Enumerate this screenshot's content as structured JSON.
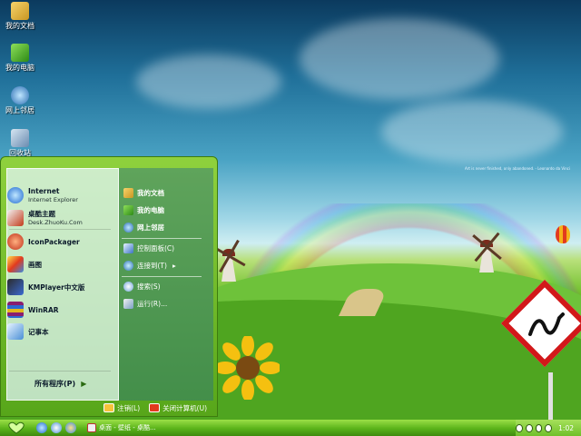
{
  "desktop": {
    "icons": [
      {
        "label": "我的文档",
        "icon": "my-documents-icon"
      },
      {
        "label": "我的电脑",
        "icon": "my-computer-icon"
      },
      {
        "label": "网上邻居",
        "icon": "network-places-icon"
      },
      {
        "label": "回收站",
        "icon": "recycle-bin-icon"
      }
    ],
    "wallpaper_quote": "Art is never finished, only abandoned. - Leonardo da Vinci"
  },
  "start_menu": {
    "pinned": [
      {
        "title": "Internet",
        "subtitle": "Internet Explorer",
        "icon": "ie-icon"
      },
      {
        "title": "桌酷主题",
        "subtitle": "Desk.ZhuoKu.Com",
        "icon": "zhuoku-icon"
      }
    ],
    "recent": [
      {
        "title": "IconPackager",
        "icon": "iconpackager-icon"
      },
      {
        "title": "画图",
        "icon": "paint-icon"
      },
      {
        "title": "KMPlayer中文版",
        "icon": "kmplayer-icon"
      },
      {
        "title": "WinRAR",
        "icon": "winrar-icon"
      },
      {
        "title": "记事本",
        "icon": "notepad-icon"
      }
    ],
    "all_programs": "所有程序(P)",
    "right": [
      {
        "label": "我的文档",
        "icon": "my-documents-icon"
      },
      {
        "label": "我的电脑",
        "icon": "my-computer-icon"
      },
      {
        "label": "网上邻居",
        "icon": "network-places-icon"
      },
      {
        "label": "控制面板(C)",
        "icon": "control-panel-icon"
      },
      {
        "label": "连接到(T)",
        "icon": "connect-to-icon"
      },
      {
        "label": "搜索(S)",
        "icon": "search-icon"
      },
      {
        "label": "运行(R)...",
        "icon": "run-icon"
      }
    ],
    "logoff": "注销(L)",
    "shutdown": "关闭计算机(U)"
  },
  "taskbar": {
    "task_label": "桌面 - 壁纸 - 桌酷...",
    "clock": "1:02"
  },
  "colors": {
    "taskbar_green": "#5ab31a",
    "menu_green": "#57a61a",
    "sign_red": "#d2181a"
  }
}
